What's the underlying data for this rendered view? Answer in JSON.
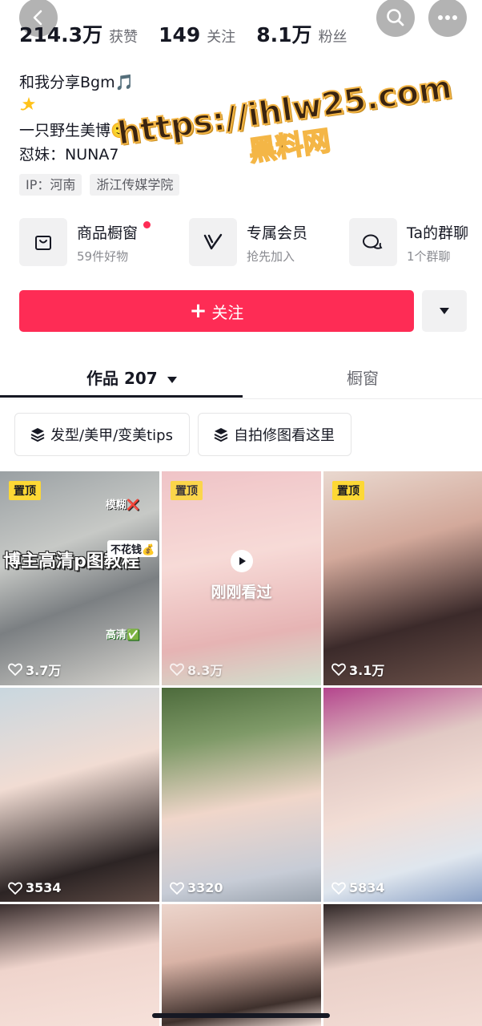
{
  "nav": {
    "back_icon": "chevron-left-icon",
    "search_icon": "search-icon",
    "more_icon": "more-dots-icon"
  },
  "stats": [
    {
      "value": "214.3万",
      "label": "获赞"
    },
    {
      "value": "149",
      "label": "关注"
    },
    {
      "value": "8.1万",
      "label": "粉丝"
    }
  ],
  "bio": {
    "line1": "和我分享Bgm🎵",
    "line2_icon": "dizzy-star-emoji",
    "line3": "一只野生美博🙂",
    "line4": "怼妹：NUNA7"
  },
  "tags": [
    "IP：河南",
    "浙江传媒学院"
  ],
  "features": [
    {
      "title": "商品橱窗",
      "sub": "59件好物",
      "icon": "shopping-bag-icon",
      "has_dot": true
    },
    {
      "title": "专属会员",
      "sub": "抢先加入",
      "icon": "vip-v-icon",
      "has_dot": false
    },
    {
      "title": "Ta的群聊",
      "sub": "1个群聊",
      "icon": "chat-bubbles-icon",
      "has_dot": false
    }
  ],
  "follow": {
    "label": "关注",
    "dropdown_icon": "caret-down-icon"
  },
  "tabs": {
    "works": "作品 207",
    "shop": "橱窗"
  },
  "collections": [
    "发型/美甲/变美tips",
    "自拍修图看这里"
  ],
  "videos": [
    {
      "pinned": true,
      "pin_label": "置顶",
      "likes": "3.7万",
      "title": "博主高清p图教程",
      "stickers": [
        "模糊❌",
        "不花钱💰",
        "高清✅"
      ]
    },
    {
      "pinned": true,
      "pin_label": "置顶",
      "likes": "8.3万",
      "seen": "刚刚看过"
    },
    {
      "pinned": true,
      "pin_label": "置顶",
      "likes": "3.1万"
    },
    {
      "pinned": false,
      "likes": "3534"
    },
    {
      "pinned": false,
      "likes": "3320"
    },
    {
      "pinned": false,
      "likes": "5834"
    },
    {
      "pinned": false
    },
    {
      "pinned": false
    },
    {
      "pinned": false
    }
  ],
  "watermark": {
    "url": "https://ihlw25.com",
    "sub": "黑料网"
  },
  "colors": {
    "accent": "#fe2c55",
    "pin": "#fdd835",
    "text": "#161823"
  }
}
